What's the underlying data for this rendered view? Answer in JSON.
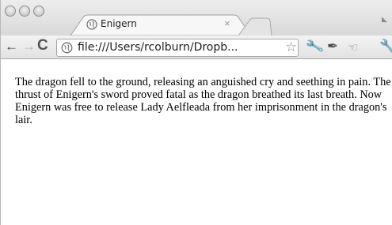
{
  "tab": {
    "title": "Enigern",
    "close_glyph": "×",
    "favicon": "globe-icon"
  },
  "toolbar": {
    "back_glyph": "←",
    "forward_glyph": "→",
    "reload_glyph": "C",
    "url": "file:///Users/rcolburn/Dropb...",
    "star_glyph": "☆",
    "icons": [
      "wrench-icon",
      "pin-icon",
      "hand-icon",
      "wrench-icon"
    ]
  },
  "page": {
    "paragraph": "The dragon fell to the ground, releasing an anguished cry and seething in pain. The thrust of Enigern's sword proved fatal as the dragon breathed its last breath. Now Enigern was free to release Lady Aelfleada from her imprisonment in the dragon's lair."
  }
}
